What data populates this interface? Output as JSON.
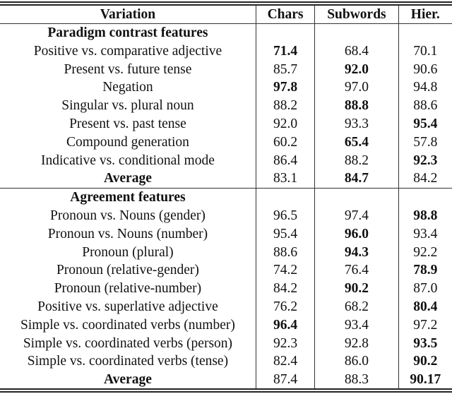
{
  "table": {
    "headers": [
      "Variation",
      "Chars",
      "Subwords",
      "Hier."
    ],
    "sections": [
      {
        "title": "Paradigm contrast features",
        "rows": [
          {
            "label": "Positive vs. comparative adjective",
            "values": [
              "71.4",
              "68.4",
              "70.1"
            ],
            "best": 0
          },
          {
            "label": "Present vs. future tense",
            "values": [
              "85.7",
              "92.0",
              "90.6"
            ],
            "best": 1
          },
          {
            "label": "Negation",
            "values": [
              "97.8",
              "97.0",
              "94.8"
            ],
            "best": 0
          },
          {
            "label": "Singular vs. plural noun",
            "values": [
              "88.2",
              "88.8",
              "88.6"
            ],
            "best": 1
          },
          {
            "label": "Present vs. past tense",
            "values": [
              "92.0",
              "93.3",
              "95.4"
            ],
            "best": 2
          },
          {
            "label": "Compound generation",
            "values": [
              "60.2",
              "65.4",
              "57.8"
            ],
            "best": 1
          },
          {
            "label": "Indicative vs. conditional mode",
            "values": [
              "86.4",
              "88.2",
              "92.3"
            ],
            "best": 2
          }
        ],
        "average": {
          "label": "Average",
          "values": [
            "83.1",
            "84.7",
            "84.2"
          ],
          "best": 1
        }
      },
      {
        "title": "Agreement features",
        "rows": [
          {
            "label": "Pronoun vs. Nouns (gender)",
            "values": [
              "96.5",
              "97.4",
              "98.8"
            ],
            "best": 2
          },
          {
            "label": "Pronoun vs. Nouns (number)",
            "values": [
              "95.4",
              "96.0",
              "93.4"
            ],
            "best": 1
          },
          {
            "label": "Pronoun (plural)",
            "values": [
              "88.6",
              "94.3",
              "92.2"
            ],
            "best": 1
          },
          {
            "label": "Pronoun (relative-gender)",
            "values": [
              "74.2",
              "76.4",
              "78.9"
            ],
            "best": 2
          },
          {
            "label": "Pronoun (relative-number)",
            "values": [
              "84.2",
              "90.2",
              "87.0"
            ],
            "best": 1
          },
          {
            "label": "Positive vs. superlative adjective",
            "values": [
              "76.2",
              "68.2",
              "80.4"
            ],
            "best": 2
          },
          {
            "label": "Simple vs. coordinated verbs (number)",
            "values": [
              "96.4",
              "93.4",
              "97.2"
            ],
            "best": 0
          },
          {
            "label": "Simple vs. coordinated verbs (person)",
            "values": [
              "92.3",
              "92.8",
              "93.5"
            ],
            "best": 2
          },
          {
            "label": "Simple vs. coordinated verbs (tense)",
            "values": [
              "82.4",
              "86.0",
              "90.2"
            ],
            "best": 2
          }
        ],
        "average": {
          "label": "Average",
          "values": [
            "87.4",
            "88.3",
            "90.17"
          ],
          "best": 2
        }
      }
    ]
  }
}
